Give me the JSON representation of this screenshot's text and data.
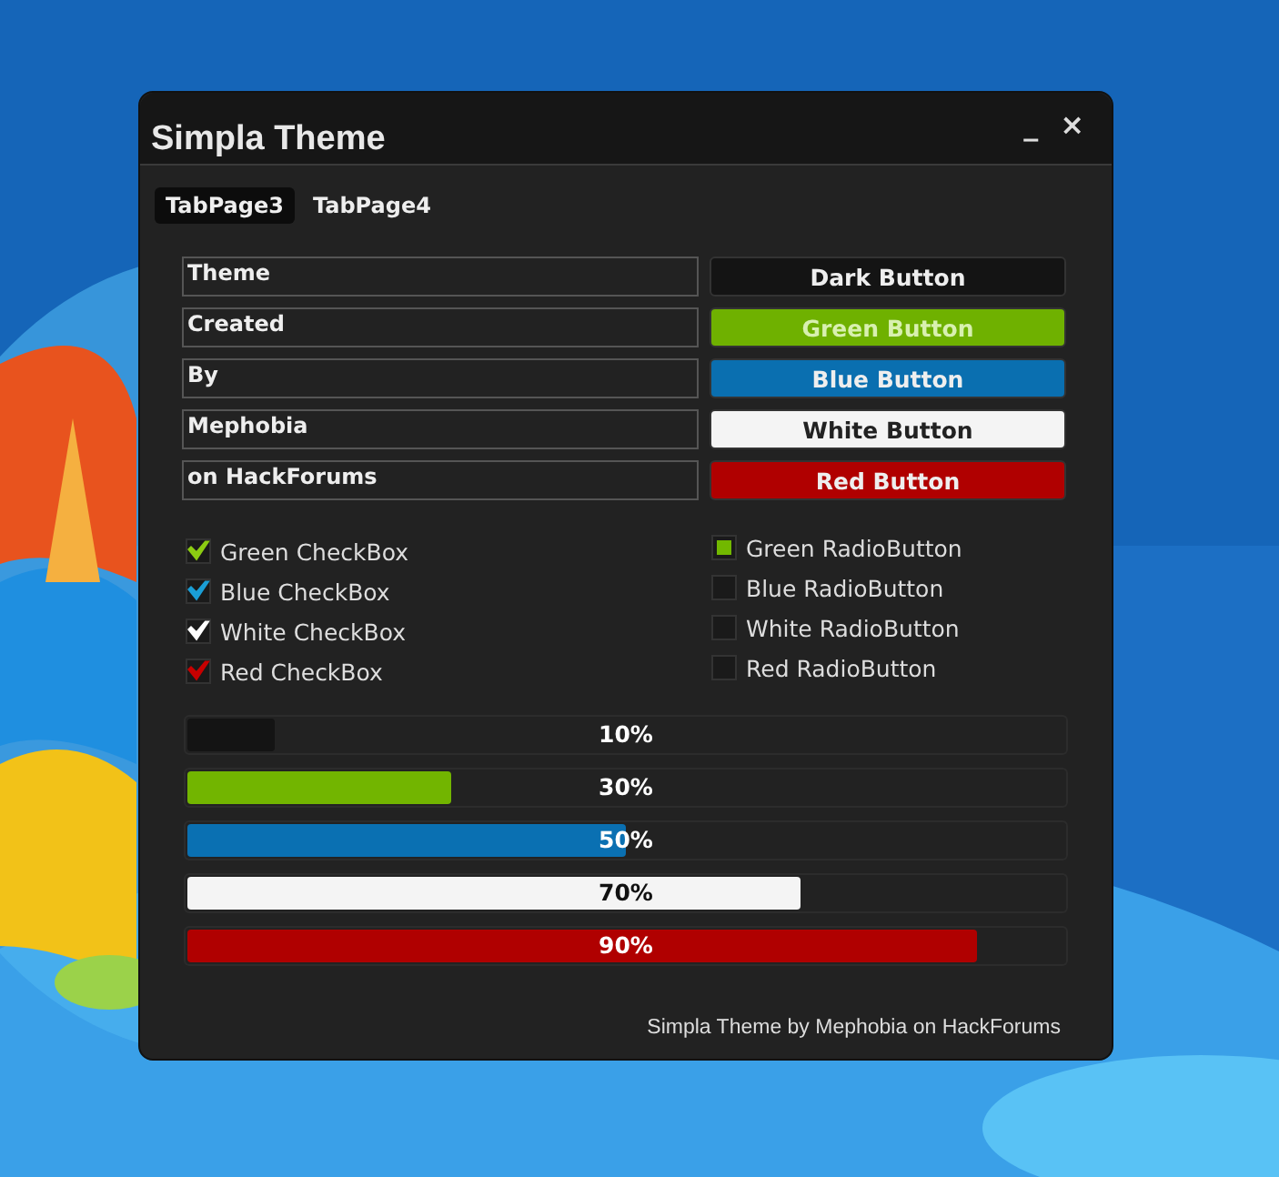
{
  "window": {
    "title": "Simpla Theme",
    "controls": [
      "_",
      "×"
    ]
  },
  "tabs": [
    {
      "label": "TabPage3",
      "selected": true
    },
    {
      "label": "TabPage4",
      "selected": false
    }
  ],
  "fields": [
    {
      "value": "Theme"
    },
    {
      "value": "Created"
    },
    {
      "value": "By"
    },
    {
      "value": "Mephobia"
    },
    {
      "value": "on HackForums"
    }
  ],
  "buttons": [
    {
      "label": "Dark Button",
      "color": "#141414"
    },
    {
      "label": "Green Button",
      "color": "#6fb100"
    },
    {
      "label": "Blue Button",
      "color": "#0a6fb0"
    },
    {
      "label": "White Button",
      "color": "#f4f4f4"
    },
    {
      "label": "Red Button",
      "color": "#b00000"
    }
  ],
  "checkboxes": [
    {
      "label": "Green CheckBox",
      "checked": true,
      "color": "#8ccc12"
    },
    {
      "label": "Blue CheckBox",
      "checked": true,
      "color": "#1a9ed6"
    },
    {
      "label": "White CheckBox",
      "checked": true,
      "color": "#ffffff"
    },
    {
      "label": "Red CheckBox",
      "checked": true,
      "color": "#c80000"
    }
  ],
  "radio_buttons": [
    {
      "label": "Green RadioButton",
      "selected": true,
      "color": "#72b800"
    },
    {
      "label": "Blue RadioButton",
      "selected": false
    },
    {
      "label": "White RadioButton",
      "selected": false
    },
    {
      "label": "Red RadioButton",
      "selected": false
    }
  ],
  "progress_bars": [
    {
      "reading": "10%",
      "level": 0.1,
      "color": "#141414"
    },
    {
      "reading": "30%",
      "level": 0.3,
      "color": "#72b500"
    },
    {
      "reading": "50%",
      "level": 0.5,
      "color": "#0a70b2"
    },
    {
      "reading": "70%",
      "level": 0.7,
      "color": "#f4f4f4"
    },
    {
      "reading": "90%",
      "level": 0.9,
      "color": "#b00000"
    }
  ],
  "footer": "Simpla Theme by Mephobia on HackForums"
}
